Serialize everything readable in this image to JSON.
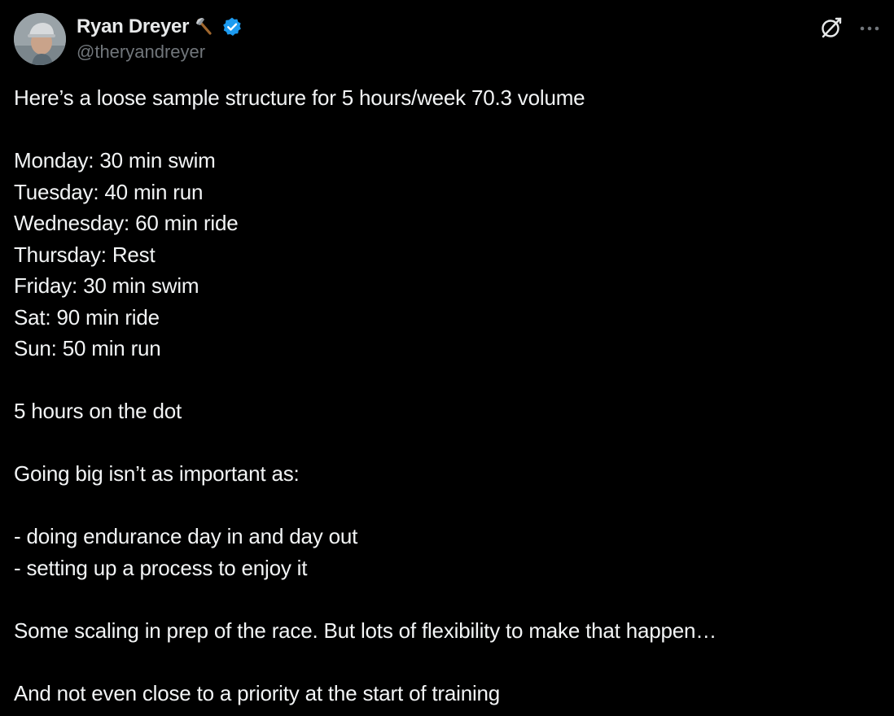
{
  "author": {
    "display_name": "Ryan Dreyer",
    "handle": "@theryandreyer",
    "emoji_icon": "axe-icon",
    "verified_icon": "verified-badge-icon"
  },
  "actions": {
    "grok_icon": "grok-icon",
    "more_icon": "more-options-icon"
  },
  "post": {
    "intro": "Here’s a loose sample structure for 5 hours/week 70.3 volume",
    "schedule": [
      "Monday: 30 min swim",
      "Tuesday: 40 min run",
      "Wednesday: 60 min ride",
      "Thursday: Rest",
      "Friday: 30 min swim",
      "Sat: 90 min ride",
      "Sun: 50 min run"
    ],
    "summary": "5 hours on the dot",
    "point_intro": "Going big isn’t as important as:",
    "points": [
      "- doing endurance day in and day out",
      "- setting up a process to enjoy it"
    ],
    "scaling": "Some scaling in prep of the race. But lots of flexibility to make that happen…",
    "closing": "And not even close to a priority at the start of training"
  },
  "colors": {
    "background": "#000000",
    "text": "#e7e9ea",
    "secondary_text": "#71767b",
    "verified_blue": "#1d9bf0"
  }
}
